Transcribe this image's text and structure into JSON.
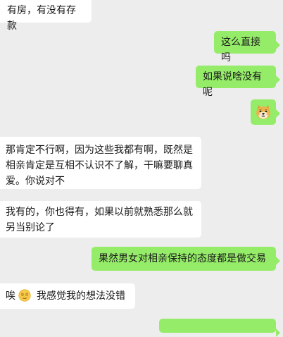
{
  "messages": [
    {
      "id": "m1",
      "side": "incoming",
      "text": "有房，有没有存款"
    },
    {
      "id": "m2",
      "side": "outgoing",
      "text": "这么直接吗"
    },
    {
      "id": "m3",
      "side": "outgoing",
      "text": "如果说啥没有呢"
    },
    {
      "id": "m4",
      "side": "outgoing",
      "sticker": "doge-emoji"
    },
    {
      "id": "m5",
      "side": "incoming",
      "text": "那肯定不行啊，因为这些我都有啊，既然是\n相亲肯定是互相不认识不了解，干嘛要聊真\n爱。你说对不"
    },
    {
      "id": "m6",
      "side": "incoming",
      "text": "我有的，你也得有，如果以前就熟悉那么就\n另当别论了"
    },
    {
      "id": "m7",
      "side": "outgoing",
      "text": "果然男女对相亲保持的态度都是做交易"
    },
    {
      "id": "m8",
      "side": "incoming",
      "prefix": "唉",
      "emoji": "relieved-face-emoji",
      "text": "我感觉我的想法没错"
    },
    {
      "id": "m9",
      "side": "outgoing",
      "text": ""
    }
  ],
  "colors": {
    "background": "#ededed",
    "incoming_bubble": "#ffffff",
    "outgoing_bubble": "#95ec69",
    "text": "#191919"
  }
}
